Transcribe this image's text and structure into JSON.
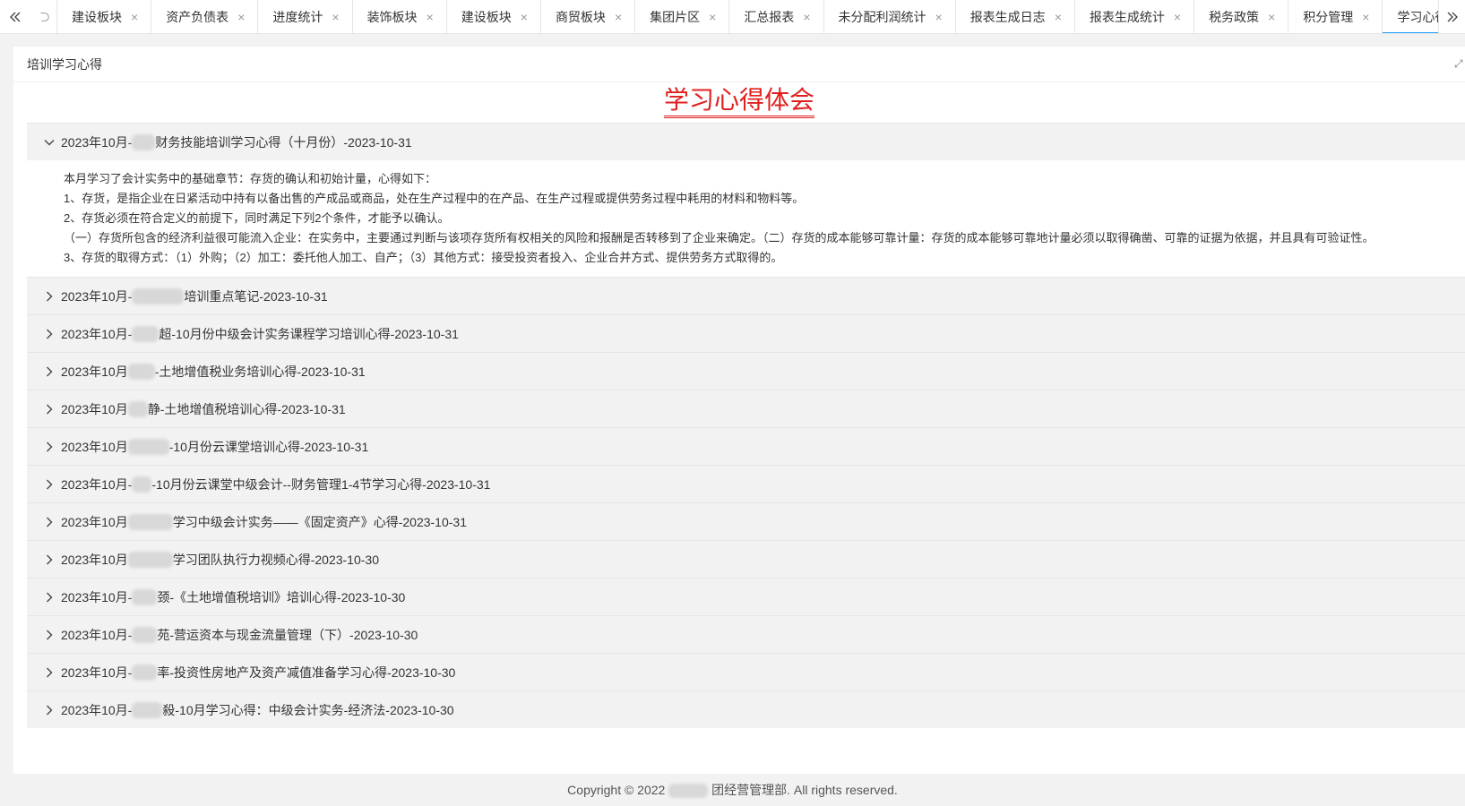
{
  "tabbar": {
    "tabs": [
      {
        "label": "建设板块"
      },
      {
        "label": "资产负债表"
      },
      {
        "label": "进度统计"
      },
      {
        "label": "装饰板块"
      },
      {
        "label": "建设板块"
      },
      {
        "label": "商贸板块"
      },
      {
        "label": "集团片区"
      },
      {
        "label": "汇总报表"
      },
      {
        "label": "未分配利润统计"
      },
      {
        "label": "报表生成日志"
      },
      {
        "label": "报表生成统计"
      },
      {
        "label": "税务政策"
      },
      {
        "label": "积分管理"
      },
      {
        "label": "学习心得",
        "active": true
      }
    ],
    "close_glyph": "×"
  },
  "panel": {
    "header": "培训学习心得",
    "title": "学习心得体会"
  },
  "items": [
    {
      "prefix": "2023年10月-",
      "suffix": "财务技能培训学习心得（十月份）-2023-10-31",
      "expanded": true
    },
    {
      "prefix": "2023年10月-",
      "suffix": "培训重点笔记-2023-10-31"
    },
    {
      "prefix": "2023年10月-",
      "suffix": "超-10月份中级会计实务课程学习培训心得-2023-10-31"
    },
    {
      "prefix": "2023年10月",
      "suffix": "-土地增值税业务培训心得-2023-10-31"
    },
    {
      "prefix": "2023年10月",
      "suffix": "静-土地增值税培训心得-2023-10-31"
    },
    {
      "prefix": "2023年10月",
      "suffix": "-10月份云课堂培训心得-2023-10-31"
    },
    {
      "prefix": "2023年10月-",
      "suffix": "-10月份云课堂中级会计--财务管理1-4节学习心得-2023-10-31"
    },
    {
      "prefix": "2023年10月",
      "suffix": "学习中级会计实务——《固定资产》心得-2023-10-31"
    },
    {
      "prefix": "2023年10月",
      "suffix": "学习团队执行力视频心得-2023-10-30"
    },
    {
      "prefix": "2023年10月-",
      "suffix": "颈-《土地增值税培训》培训心得-2023-10-30"
    },
    {
      "prefix": "2023年10月-",
      "suffix": "苑-营运资本与现金流量管理（下）-2023-10-30"
    },
    {
      "prefix": "2023年10月-",
      "suffix": "率-投资性房地产及资产减值准备学习心得-2023-10-30"
    },
    {
      "prefix": "2023年10月-",
      "suffix": "殺-10月学习心得：中级会计实务-经济法-2023-10-30"
    }
  ],
  "expanded_body": [
    "本月学习了会计实务中的基础章节：存货的确认和初始计量，心得如下：",
    "1、存货，是指企业在日紧活动中持有以备出售的产成品或商品，处在生产过程中的在产品、在生产过程或提供劳务过程中耗用的材料和物料等。",
    "2、存货必须在符合定义的前提下，同时满足下列2个条件，才能予以确认。",
    "（一）存货所包含的经济利益很可能流入企业：在实务中，主要通过判断与该项存货所有权相关的风险和报酬是否转移到了企业来确定。（二）存货的成本能够可靠计量：存货的成本能够可靠地计量必须以取得确凿、可靠的证据为依据，并且具有可验证性。",
    "3、存货的取得方式：（1）外购；（2）加工：委托他人加工、自产；（3）其他方式：接受投资者投入、企业合并方式、提供劳务方式取得的。"
  ],
  "footer": {
    "prefix": "Copyright © 2022",
    "suffix": "团经营管理部. All rights reserved."
  },
  "colors": {
    "accent": "#1e9fff",
    "title_red": "#e02020",
    "row_bg": "#f2f2f2"
  }
}
